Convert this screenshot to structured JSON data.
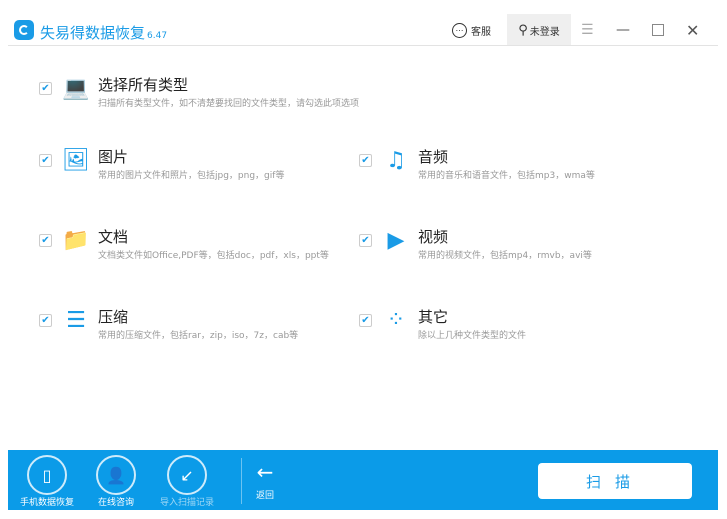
{
  "app": {
    "title": "失易得数据恢复",
    "version": "6.47"
  },
  "titlebar": {
    "service": "客服",
    "login": "未登录"
  },
  "types": [
    {
      "title": "选择所有类型",
      "desc": "扫描所有类型文件，如不清楚要找回的文件类型，请勾选此项选项",
      "checked": true,
      "icon": "laptop-icon"
    },
    {
      "title": "图片",
      "desc": "常用的图片文件和照片，包括jpg，png，gif等",
      "checked": true,
      "icon": "image-icon"
    },
    {
      "title": "音频",
      "desc": "常用的音乐和语音文件，包括mp3，wma等",
      "checked": true,
      "icon": "music-icon"
    },
    {
      "title": "文档",
      "desc": "文档类文件如Office,PDF等，包括doc，pdf，xls，ppt等",
      "checked": true,
      "icon": "folder-icon"
    },
    {
      "title": "视频",
      "desc": "常用的视频文件，包括mp4，rmvb，avi等",
      "checked": true,
      "icon": "play-icon"
    },
    {
      "title": "压缩",
      "desc": "常用的压缩文件，包括rar，zip，iso，7z，cab等",
      "checked": true,
      "icon": "archive-icon"
    },
    {
      "title": "其它",
      "desc": "除以上几种文件类型的文件",
      "checked": true,
      "icon": "other-icon"
    }
  ],
  "bottom": {
    "phone": "手机数据恢复",
    "consult": "在线咨询",
    "import": "导入扫描记录",
    "back": "返回",
    "scan": "扫描"
  },
  "colors": {
    "accent": "#0b9be8"
  }
}
